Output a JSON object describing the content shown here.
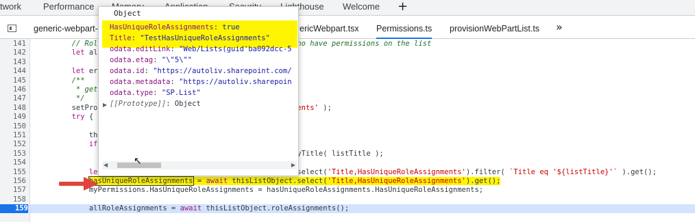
{
  "top_tabs": [
    "twork",
    "Performance",
    "Memory",
    "Application",
    "Security",
    "Lighthouse",
    "Welcome"
  ],
  "top_add": "+",
  "file_tabs": [
    "generic-webpart-",
    "ericWebpart.tsx",
    "Permissions.ts",
    "provisionWebPartList.ts"
  ],
  "more_tabs": "»",
  "popover": {
    "title": "Object",
    "props": [
      {
        "key": "HasUniqueRoleAssignments",
        "value": "true"
      },
      {
        "key": "Title",
        "value": "\"TestHasUniqueRoleAssignments\""
      },
      {
        "key": "odata.editLink",
        "value": "\"Web/Lists(guid'ba092dcc-5"
      },
      {
        "key": "odata.etag",
        "value": "\"\\\"5\\\"\""
      },
      {
        "key": "odata.id",
        "value": "\"https://autoliv.sharepoint.com/"
      },
      {
        "key": "odata.metadata",
        "value": "\"https://autoliv.sharepoin"
      },
      {
        "key": "odata.type",
        "value": "\"SP.List\""
      }
    ],
    "proto_key": "[[Prototype]]",
    "proto_value": "Object"
  },
  "lines": [
    {
      "n": "141",
      "segments": [
        {
          "t": "        "
        },
        {
          "t": "// Role",
          "c": "cm"
        },
        {
          "t": "                                            "
        },
        {
          "t": "who have permissions on the list",
          "c": "cm"
        }
      ]
    },
    {
      "n": "142",
      "segments": [
        {
          "t": "        "
        },
        {
          "t": "let",
          "c": "kw"
        },
        {
          "t": " all"
        }
      ]
    },
    {
      "n": "143",
      "segments": []
    },
    {
      "n": "144",
      "segments": [
        {
          "t": "        "
        },
        {
          "t": "let",
          "c": "kw"
        },
        {
          "t": " err"
        }
      ]
    },
    {
      "n": "145",
      "segments": [
        {
          "t": "        "
        },
        {
          "t": "/**",
          "c": "cm"
        }
      ]
    },
    {
      "n": "146",
      "segments": [
        {
          "t": "         "
        },
        {
          "t": "* get",
          "c": "cm"
        }
      ]
    },
    {
      "n": "147",
      "segments": [
        {
          "t": "         "
        },
        {
          "t": "*/",
          "c": "cm"
        }
      ]
    },
    {
      "n": "148",
      "segments": [
        {
          "t": "        setProg"
        },
        {
          "t": "                                       "
        },
        {
          "t": "ssignments'",
          "c": "str"
        },
        {
          "t": " );"
        }
      ]
    },
    {
      "n": "149",
      "segments": [
        {
          "t": "        "
        },
        {
          "t": "try",
          "c": "kw"
        },
        {
          "t": " {"
        }
      ]
    },
    {
      "n": "150",
      "segments": []
    },
    {
      "n": "151",
      "segments": [
        {
          "t": "            thi"
        }
      ]
    },
    {
      "n": "152",
      "segments": [
        {
          "t": "            "
        },
        {
          "t": "if",
          "c": "kw"
        }
      ]
    },
    {
      "n": "153",
      "segments": [
        {
          "t": "                                                         "
        },
        {
          "t": "etByTitle( listTitle );"
        }
      ]
    },
    {
      "n": "154",
      "segments": []
    },
    {
      "n": "155",
      "segments": [
        {
          "t": "            "
        },
        {
          "t": "let",
          "c": "kw"
        },
        {
          "t": " temp.thisList = "
        },
        {
          "t": "await",
          "c": "kw"
        },
        {
          "t": " thisWebInstance.lists.select("
        },
        {
          "t": "'Title,HasUniqueRoleAssignments'",
          "c": "str"
        },
        {
          "t": ").filter( "
        },
        {
          "t": "`Title eq '${listTitle}'`",
          "c": "str"
        },
        {
          "t": " ).get();"
        }
      ]
    },
    {
      "n": "156",
      "segments": [
        {
          "t": "            "
        },
        {
          "t": "hasUniqueRoleAssignments",
          "c": "hl hlbox"
        },
        {
          "t": " ",
          "c": "hl"
        },
        {
          "t": "= ",
          "c": "hl"
        },
        {
          "t": "await",
          "c": "hl kw"
        },
        {
          "t": " thisListObject.select(",
          "c": "hl"
        },
        {
          "t": "'Title,HasUniqueRoleAssignments'",
          "c": "hl str"
        },
        {
          "t": ").get();",
          "c": "hl"
        }
      ]
    },
    {
      "n": "157",
      "segments": [
        {
          "t": "            myPermissions.HasUniqueRoleAssignments = hasUniqueRoleAssignments.HasUniqueRoleAssignments;"
        }
      ]
    },
    {
      "n": "158",
      "segments": []
    },
    {
      "n": "159",
      "breakpoint": true,
      "segments": [
        {
          "t": "            allRoleAssignments = "
        },
        {
          "t": "await",
          "c": "kw await-hl"
        },
        {
          "t": " thisListObject.roleAssignments();"
        }
      ]
    }
  ]
}
